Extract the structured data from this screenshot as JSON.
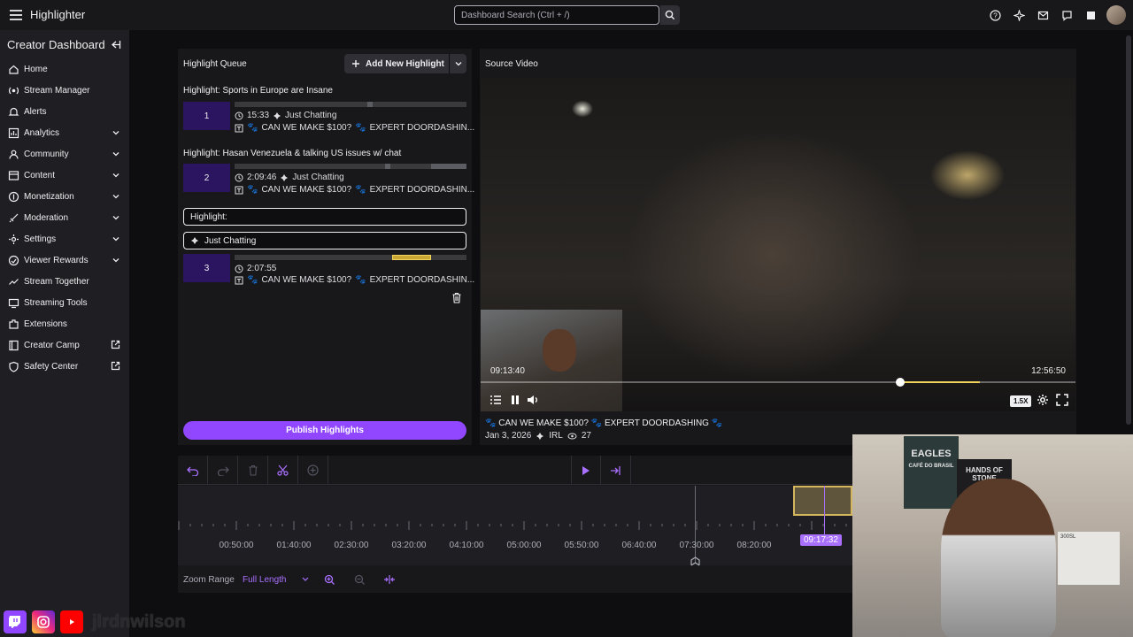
{
  "app": {
    "title": "Highlighter"
  },
  "search": {
    "placeholder": "Dashboard Search (Ctrl + /)"
  },
  "sidebar": {
    "heading": "Creator Dashboard",
    "items": [
      {
        "label": "Home",
        "icon": "home-icon",
        "expandable": false
      },
      {
        "label": "Stream Manager",
        "icon": "stream-manager-icon",
        "expandable": false
      },
      {
        "label": "Alerts",
        "icon": "bell-icon",
        "expandable": false
      },
      {
        "label": "Analytics",
        "icon": "analytics-icon",
        "expandable": true
      },
      {
        "label": "Community",
        "icon": "community-icon",
        "expandable": true
      },
      {
        "label": "Content",
        "icon": "content-icon",
        "expandable": true
      },
      {
        "label": "Monetization",
        "icon": "monetization-icon",
        "expandable": true
      },
      {
        "label": "Moderation",
        "icon": "sword-icon",
        "expandable": true
      },
      {
        "label": "Settings",
        "icon": "gear-icon",
        "expandable": true
      },
      {
        "label": "Viewer Rewards",
        "icon": "rewards-icon",
        "expandable": true
      },
      {
        "label": "Stream Together",
        "icon": "stream-together-icon",
        "expandable": false
      },
      {
        "label": "Streaming Tools",
        "icon": "streaming-tools-icon",
        "expandable": false
      },
      {
        "label": "Extensions",
        "icon": "extensions-icon",
        "expandable": false
      },
      {
        "label": "Creator Camp",
        "icon": "creator-camp-icon",
        "external": true
      },
      {
        "label": "Safety Center",
        "icon": "shield-icon",
        "external": true
      }
    ]
  },
  "queue": {
    "title": "Highlight Queue",
    "add_label": "Add New Highlight",
    "highlights": [
      {
        "title": "Highlight: Sports in Europe are Insane",
        "number": "1",
        "duration": "15:33",
        "category": "Just Chatting",
        "stream_title": "CAN WE MAKE $100?",
        "stream_title2": "EXPERT DOORDASHIN..."
      },
      {
        "title": "Highlight: Hasan Venezuela & talking US issues w/ chat",
        "number": "2",
        "duration": "2:09:46",
        "category": "Just Chatting",
        "stream_title": "CAN WE MAKE $100?",
        "stream_title2": "EXPERT DOORDASHIN..."
      },
      {
        "title_input": "Highlight:",
        "category_input": "Just Chatting",
        "number": "3",
        "duration": "2:07:55",
        "stream_title": "CAN WE MAKE $100?",
        "stream_title2": "EXPERT DOORDASHIN..."
      }
    ],
    "publish_label": "Publish Highlights"
  },
  "source": {
    "title": "Source Video",
    "time_start": "09:13:40",
    "time_end": "12:56:50",
    "speed": "1.5X",
    "stream_title": "CAN WE MAKE $100?",
    "stream_title2": "EXPERT DOORDASHING",
    "date": "Jan 3, 2026",
    "category": "IRL",
    "viewers": "27"
  },
  "timeline": {
    "ticks": [
      "00:50:00",
      "01:40:00",
      "02:30:00",
      "03:20:00",
      "04:10:00",
      "05:00:00",
      "05:50:00",
      "06:40:00",
      "07:30:00",
      "08:20:00"
    ],
    "current_time": "09:17:32",
    "zoom_label": "Zoom Range",
    "zoom_value": "Full Length"
  },
  "webcam": {
    "poster_text": "EAGLES",
    "poster_sub": "CAFÉ DO BRASIL",
    "hands_text": "HANDS OF STONE",
    "card_text": "300SL"
  },
  "social": {
    "handle": "jlrdnwilson"
  },
  "colors": {
    "accent": "#9147ff",
    "accent_light": "#a970ff",
    "highlight_num_bg": "#2b1560",
    "clip_border": "#d3b65e"
  }
}
